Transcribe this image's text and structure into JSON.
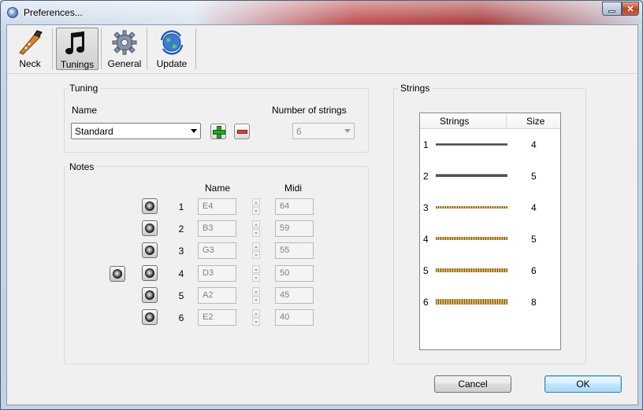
{
  "window": {
    "title": "Preferences..."
  },
  "toolbar": {
    "items": [
      {
        "label": "Neck",
        "icon": "guitar-neck-icon"
      },
      {
        "label": "Tunings",
        "icon": "music-notes-icon",
        "selected": true
      },
      {
        "label": "General",
        "icon": "gear-icon"
      },
      {
        "label": "Update",
        "icon": "update-globe-icon"
      }
    ]
  },
  "tuning": {
    "title": "Tuning",
    "name_label": "Name",
    "name_value": "Standard",
    "strings_label": "Number of strings",
    "strings_value": "6"
  },
  "notes": {
    "title": "Notes",
    "name_header": "Name",
    "midi_header": "Midi",
    "rows": [
      {
        "num": "1",
        "name": "E4",
        "midi": "64"
      },
      {
        "num": "2",
        "name": "B3",
        "midi": "59"
      },
      {
        "num": "3",
        "name": "G3",
        "midi": "55"
      },
      {
        "num": "4",
        "name": "D3",
        "midi": "50"
      },
      {
        "num": "5",
        "name": "A2",
        "midi": "45"
      },
      {
        "num": "6",
        "name": "E2",
        "midi": "40"
      }
    ]
  },
  "strings": {
    "title": "Strings",
    "col_strings": "Strings",
    "col_size": "Size",
    "rows": [
      {
        "num": "1",
        "size": "4",
        "type": "plain"
      },
      {
        "num": "2",
        "size": "5",
        "type": "plain"
      },
      {
        "num": "3",
        "size": "4",
        "type": "wound"
      },
      {
        "num": "4",
        "size": "5",
        "type": "wound"
      },
      {
        "num": "5",
        "size": "6",
        "type": "wound"
      },
      {
        "num": "6",
        "size": "8",
        "type": "wound"
      }
    ]
  },
  "buttons": {
    "cancel": "Cancel",
    "ok": "OK"
  },
  "colors": {
    "wound": "#e1b25a",
    "plain": "#5a5a5a",
    "titlebar_accent": "#b53a3a"
  }
}
